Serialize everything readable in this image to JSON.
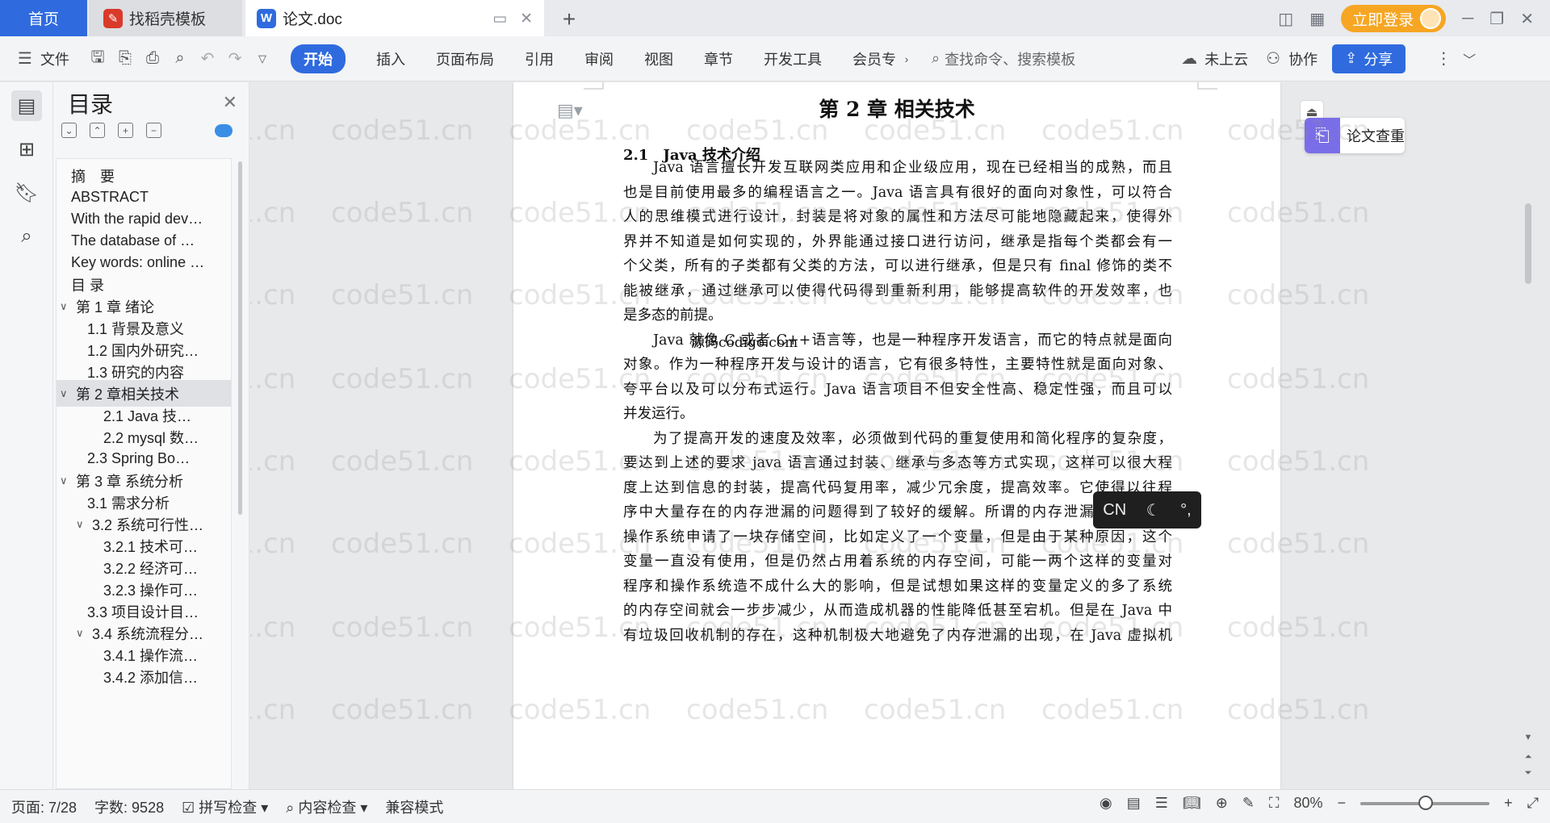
{
  "tabs": {
    "home": "首页",
    "find_template": "找稻壳模板",
    "document": "论文.doc",
    "new_tab": "+"
  },
  "topbar": {
    "login": "立即登录"
  },
  "ribbon": {
    "file": "文件",
    "menu_tabs": [
      "开始",
      "插入",
      "页面布局",
      "引用",
      "审阅",
      "视图",
      "章节",
      "开发工具",
      "会员专"
    ],
    "command_search": "查找命令、搜索模板",
    "cloud": "未上云",
    "collab": "协作",
    "share": "分享"
  },
  "toc": {
    "title": "目录",
    "items": [
      {
        "label": "摘　要",
        "level": 1
      },
      {
        "label": "ABSTRACT",
        "level": 1
      },
      {
        "label": "With the rapid dev…",
        "level": 1
      },
      {
        "label": "The database of …",
        "level": 1
      },
      {
        "label": "Key words: online …",
        "level": 1
      },
      {
        "label": "目 录",
        "level": 1
      },
      {
        "label": "第 1 章  绪论",
        "level": 1,
        "expanded": true
      },
      {
        "label": "1.1 背景及意义",
        "level": 2
      },
      {
        "label": "1.2  国内外研究…",
        "level": 2
      },
      {
        "label": "1.3  研究的内容",
        "level": 2
      },
      {
        "label": "第 2 章相关技术",
        "level": 1,
        "expanded": true,
        "selected": true
      },
      {
        "label": "2.1    Java 技…",
        "level": 3
      },
      {
        "label": "2.2 mysql 数…",
        "level": 3
      },
      {
        "label": "2.3 Spring    Bo…",
        "level": 2
      },
      {
        "label": "第 3 章  系统分析",
        "level": 1,
        "expanded": true
      },
      {
        "label": "3.1  需求分析",
        "level": 2
      },
      {
        "label": "3.2  系统可行性…",
        "level": 2,
        "expanded": true
      },
      {
        "label": "3.2.1 技术可…",
        "level": 3
      },
      {
        "label": "3.2.2 经济可…",
        "level": 3
      },
      {
        "label": "3.2.3 操作可…",
        "level": 3
      },
      {
        "label": "3.3  项目设计目…",
        "level": 2
      },
      {
        "label": "3.4 系统流程分…",
        "level": 2,
        "expanded": true
      },
      {
        "label": "3.4.1 操作流…",
        "level": 3
      },
      {
        "label": "3.4.2 添加信…",
        "level": 3
      }
    ]
  },
  "document": {
    "chapter_title": "第 2 章  相关技术",
    "section_title": "2.1　Java 技术介绍",
    "lines": [
      "Java 语言擅长开发互联网类应用和企业级应用，现在已经相当的成熟，而且",
      "也是目前使用最多的编程语言之一。Java 语言具有很好的面向对象性，可以符合",
      "人的思维模式进行设计，封装是将对象的属性和方法尽可能地隐藏起来，使得外",
      "界并不知道是如何实现的，外界能通过接口进行访问，继承是指每个类都会有一",
      "个父类，所有的子类都有父类的方法，可以进行继承，但是只有 final 修饰的类不",
      "能被继承，通过继承可以使得代码得到重新利用，能够提高软件的开发效率，也",
      "是多态的前提。",
      "Java 就像 C 或者 C++语言等，也是一种程序开发语言，而它的特点就是面向",
      "对象。作为一种程序开发与设计的语言，它有很多特性，主要特性就是面向对象、",
      "夸平台以及可以分布式运行。Java 语言项目不但安全性高、稳定性强，而且可以",
      "并发运行。",
      "为了提高开发的速度及效率，必须做到代码的重复使用和简化程序的复杂度，",
      "要达到上述的要求 java 语言通过封装、继承与多态等方式实现，这样可以很大程",
      "度上达到信息的封装，提高代码复用率，减少冗余度，提高效率。它使得以往程",
      "序中大量存在的内存泄漏的问题得到了较好的缓解。所谓的内存泄漏就是程序向",
      "操作系统申请了一块存储空间，比如定义了一个变量，但是由于某种原因，这个",
      "变量一直没有使用，但是仍然占用着系统的内存空间，可能一两个这样的变量对",
      "程序和操作系统造不成什么大的影响，但是试想如果这样的变量定义的多了系统",
      "的内存空间就会一步步减少，从而造成机器的性能降低甚至宕机。但是在 Java 中",
      "有垃圾回收机制的存在，这种机制极大地避免了内存泄漏的出现，在 Java 虚拟机"
    ],
    "overlap_text": "源码código.com",
    "watermark": "code51.cn"
  },
  "side": {
    "paper_check": "论文查重",
    "ime_label": "CN"
  },
  "statusbar": {
    "page": "页面: 7/28",
    "words": "字数: 9528",
    "spell": "拼写检查",
    "content_check": "内容检查",
    "compat": "兼容模式",
    "zoom": "80%"
  }
}
